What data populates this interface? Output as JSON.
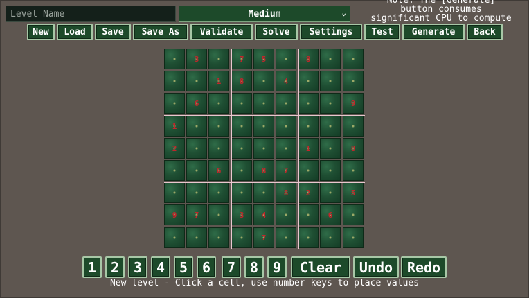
{
  "header": {
    "level_name_placeholder": "Level Name",
    "difficulty": "Medium",
    "note": "Note: The [Generate]\nbutton consumes\nsignificant CPU to compute"
  },
  "toolbar": [
    "New",
    "Load",
    "Save",
    "Save As",
    "Validate",
    "Solve",
    "Settings",
    "Test",
    "Generate",
    "Back"
  ],
  "board": {
    "grid": [
      [
        "",
        "3",
        "",
        "7",
        "5",
        "",
        "8",
        "",
        ""
      ],
      [
        "",
        "",
        "1",
        "8",
        "",
        "4",
        "",
        "",
        ""
      ],
      [
        "",
        "6",
        "",
        "",
        "",
        "",
        "",
        "",
        "9"
      ],
      [
        "1",
        "",
        "",
        "",
        "",
        "",
        "",
        "",
        ""
      ],
      [
        "2",
        "",
        "",
        "",
        "",
        "",
        "1",
        "",
        "8"
      ],
      [
        "",
        "",
        "6",
        "",
        "8",
        "7",
        "",
        "",
        ""
      ],
      [
        "",
        "",
        "",
        "",
        "",
        "8",
        "2",
        "",
        "5"
      ],
      [
        "9",
        "7",
        "",
        "3",
        "4",
        "",
        "",
        "6",
        ""
      ],
      [
        "",
        "",
        "",
        "",
        "7",
        "",
        "",
        "",
        ""
      ]
    ],
    "colors": {
      "digit": "#c0262b",
      "box_line": "#e9c7cf",
      "cell": "#1f4f33"
    }
  },
  "numpad": [
    "1",
    "2",
    "3",
    "4",
    "5",
    "6",
    "7",
    "8",
    "9",
    "Clear",
    "Undo",
    "Redo"
  ],
  "status": "New level - Click a cell, use number keys to place values"
}
